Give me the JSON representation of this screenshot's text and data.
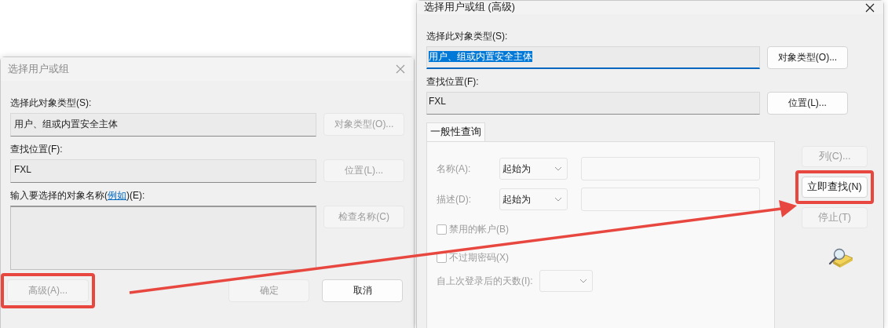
{
  "left_dialog": {
    "title": "选择用户或组",
    "active": false,
    "object_type": {
      "label": "选择此对象类型(S):",
      "value": "用户、组或内置安全主体",
      "button": {
        "label": "对象类型(O)...",
        "disabled": true
      }
    },
    "location": {
      "label": "查找位置(F):",
      "value": "FXL",
      "button": {
        "label": "位置(L)...",
        "disabled": true
      }
    },
    "names": {
      "label_before": "输入要选择的对象名称(",
      "link": "例如",
      "label_after": ")(E):",
      "button": {
        "label": "检查名称(C)",
        "disabled": true
      }
    },
    "footer_buttons": [
      {
        "label": "高级(A)...",
        "disabled": true,
        "highlighted": true
      },
      {
        "label": "确定",
        "disabled": true,
        "highlighted": false
      },
      {
        "label": "取消",
        "disabled": false,
        "highlighted": false
      }
    ]
  },
  "right_dialog": {
    "title": "选择用户或组 (高级)",
    "active": true,
    "object_type": {
      "label": "选择此对象类型(S):",
      "value": "用户、组或内置安全主体",
      "value_selected": true,
      "button": {
        "label": "对象类型(O)...",
        "disabled": false
      }
    },
    "location": {
      "label": "查找位置(F):",
      "value": "FXL",
      "value_selected": false,
      "button": {
        "label": "位置(L)...",
        "disabled": false
      }
    },
    "tab": {
      "label": "一般性查询",
      "selected": true
    },
    "query_rows": [
      {
        "label": "名称(A):",
        "operator": "起始为",
        "disabled": true
      },
      {
        "label": "描述(D):",
        "operator": "起始为",
        "disabled": true
      }
    ],
    "checkboxes": [
      {
        "label": "禁用的帐户(B)",
        "checked": false,
        "disabled": true
      },
      {
        "label": "不过期密码(X)",
        "checked": false,
        "disabled": true
      }
    ],
    "days": {
      "label": "自上次登录后的天数(I):",
      "disabled": true
    },
    "side_buttons": [
      {
        "label": "列(C)...",
        "disabled": true,
        "highlighted": false
      },
      {
        "label": "立即查找(N)",
        "disabled": false,
        "highlighted": true
      },
      {
        "label": "停止(T)",
        "disabled": true,
        "highlighted": false
      }
    ]
  }
}
